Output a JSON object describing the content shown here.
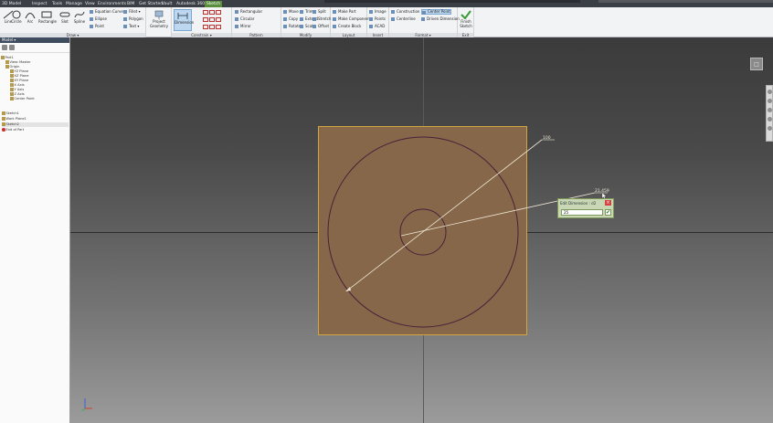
{
  "tabs": [
    "3D Model",
    "Inspect",
    "Tools",
    "Manage",
    "View",
    "Environments",
    "BIM",
    "Get Started",
    "Vault",
    "Autodesk 360",
    "Sketch"
  ],
  "active_tab": "Sketch",
  "ribbon": {
    "draw": {
      "label": "Draw ▾",
      "line": "Line",
      "circle": "Circle",
      "arc": "Arc",
      "rectangle": "Rectangle",
      "slot": "Slot",
      "spline": "Spline",
      "equation_curve": "Equation Curve",
      "ellipse": "Ellipse",
      "point": "Point",
      "fillet": "Fillet ▾",
      "polygon": "Polygon",
      "text": "Text ▾",
      "project_geometry": "Project Geometry"
    },
    "constrain": {
      "label": "Constrain ▾",
      "dimension": "Dimension"
    },
    "pattern": {
      "label": "Pattern",
      "rectangular": "Rectangular",
      "circular": "Circular",
      "mirror": "Mirror"
    },
    "modify": {
      "label": "Modify",
      "move": "Move",
      "trim": "Trim",
      "split": "Split",
      "copy": "Copy",
      "extend": "Extend",
      "stretch": "Stretch",
      "rotate": "Rotate",
      "scale": "Scale",
      "offset": "Offset"
    },
    "layout": {
      "label": "Layout",
      "make_part": "Make Part",
      "make_components": "Make Components",
      "create_block": "Create Block"
    },
    "insert": {
      "label": "Insert",
      "image": "Image",
      "points": "Points",
      "acad": "ACAD"
    },
    "format": {
      "label": "Format ▾",
      "construction": "Construction",
      "centerline": "Centerline",
      "center_point": "Center Point",
      "driven_dimension": "Driven Dimension"
    },
    "exit": {
      "label": "Exit",
      "finish_sketch": "Finish Sketch"
    }
  },
  "browser": {
    "title": "Model ▾",
    "items": [
      "Part1",
      "View: Master",
      "Origin",
      "YZ Plane",
      "XZ Plane",
      "XY Plane",
      "X Axis",
      "Y Axis",
      "Z Axis",
      "Center Point",
      "Sketch1",
      "Work Plane1",
      "Sketch2",
      "End of Part"
    ]
  },
  "sketch": {
    "dimension_label": "100",
    "dimension_label_2": "21.459"
  },
  "edit_dimension": {
    "title": "Edit Dimension : d2",
    "value": "25",
    "close_glyph": "×",
    "ok_glyph": "✔"
  },
  "viewcube_glyph": "□",
  "colors": {
    "sketch_tab": "#5a8d3c",
    "plate_fill": "#876749",
    "plate_border": "#d4a441",
    "circle_stroke": "#4a1f3a",
    "dimension_line": "#ece6d4"
  },
  "icons": [
    "line-icon",
    "circle-icon",
    "arc-icon",
    "rectangle-icon",
    "slot-icon",
    "spline-icon",
    "project-geometry-icon",
    "dimension-icon",
    "finish-sketch-checkmark-icon"
  ]
}
